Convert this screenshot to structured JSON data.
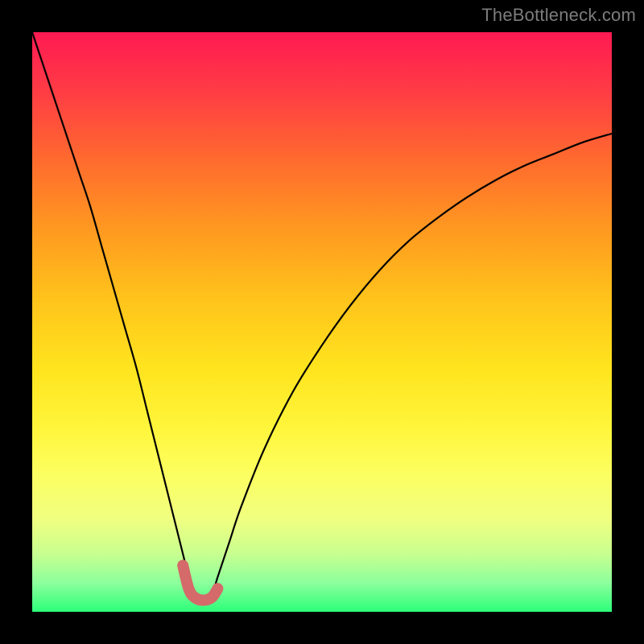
{
  "watermark": "TheBottleneck.com",
  "colors": {
    "frame": "#000000",
    "curve": "#000000",
    "highlight": "#d46a6a",
    "gradient_top": "#ff1a52",
    "gradient_bottom": "#2cff7a"
  },
  "chart_data": {
    "type": "line",
    "title": "",
    "xlabel": "",
    "ylabel": "",
    "xlim": [
      0,
      100
    ],
    "ylim": [
      0,
      100
    ],
    "grid": false,
    "legend": false,
    "annotations": [],
    "series": [
      {
        "name": "bottleneck-curve",
        "x": [
          0,
          2,
          4,
          6,
          8,
          10,
          12,
          14,
          16,
          18,
          20,
          22,
          24,
          26,
          27,
          28,
          29.5,
          31,
          32,
          34,
          36,
          40,
          45,
          50,
          55,
          60,
          65,
          70,
          75,
          80,
          85,
          90,
          95,
          100
        ],
        "y": [
          100,
          94,
          88,
          82,
          76,
          70,
          63,
          56,
          49,
          42,
          34,
          26,
          18,
          10,
          6,
          3,
          2,
          3,
          6,
          12,
          18,
          28,
          38,
          46,
          53,
          59,
          64,
          68,
          71.5,
          74.5,
          77,
          79,
          81,
          82.5
        ]
      },
      {
        "name": "highlight-u",
        "x": [
          26,
          27,
          28,
          29.5,
          31,
          32
        ],
        "y": [
          8,
          4,
          2.5,
          2,
          2.5,
          4
        ]
      }
    ]
  }
}
